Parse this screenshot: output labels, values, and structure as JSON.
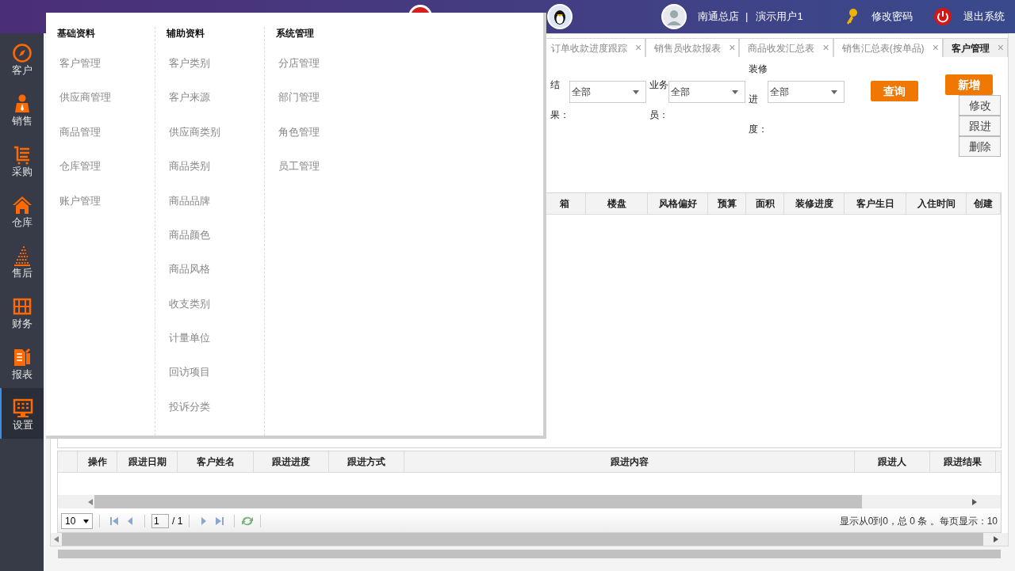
{
  "header": {
    "store": "南通总店",
    "separator": "|",
    "user": "演示用户1",
    "change_password": "修改密码",
    "logout": "退出系统"
  },
  "sidebar": {
    "items": [
      {
        "label": "客户",
        "selected": false
      },
      {
        "label": "销售",
        "selected": false
      },
      {
        "label": "采购",
        "selected": false
      },
      {
        "label": "仓库",
        "selected": false
      },
      {
        "label": "售后",
        "selected": false
      },
      {
        "label": "财务",
        "selected": false
      },
      {
        "label": "报表",
        "selected": false
      },
      {
        "label": "设置",
        "selected": true
      }
    ]
  },
  "tabs": [
    {
      "label": "订单收款进度跟踪",
      "selected": false,
      "close": "×"
    },
    {
      "label": "销售员收款报表",
      "selected": false,
      "close": "×"
    },
    {
      "label": "商品收发汇总表",
      "selected": false,
      "close": "×"
    },
    {
      "label": "销售汇总表(按单品)",
      "selected": false,
      "close": "×"
    },
    {
      "label": "客户管理",
      "selected": true,
      "close": "×"
    }
  ],
  "filters": [
    {
      "label": "结果：",
      "value": "全部"
    },
    {
      "label": "业务员：",
      "value": "全部"
    },
    {
      "label": "装修进度：",
      "value": "全部"
    }
  ],
  "search_button": "查询",
  "actions": [
    {
      "label": "新增",
      "kind": "primary"
    },
    {
      "label": "修改",
      "kind": "secondary"
    },
    {
      "label": "跟进",
      "kind": "secondary"
    },
    {
      "label": "删除",
      "kind": "secondary"
    }
  ],
  "customer_table": {
    "columns": [
      "箱",
      "楼盘",
      "风格偏好",
      "预算",
      "面积",
      "装修进度",
      "客户生日",
      "入住时间",
      "创建"
    ]
  },
  "followup_table": {
    "columns": [
      "操作",
      "跟进日期",
      "客户姓名",
      "跟进进度",
      "跟进方式",
      "跟进内容",
      "跟进人",
      "跟进结果"
    ]
  },
  "pager": {
    "page_size": "10",
    "page": "1",
    "total_pages": "/ 1",
    "summary": "显示从0到0，总 0 条 。每页显示：10"
  },
  "menu": {
    "columns": [
      {
        "title": "基础资料",
        "items": [
          "客户管理",
          "供应商管理",
          "商品管理",
          "仓库管理",
          "账户管理"
        ]
      },
      {
        "title": "辅助资料",
        "items": [
          "客户类别",
          "客户来源",
          "供应商类别",
          "商品类别",
          "商品品牌",
          "商品颜色",
          "商品风格",
          "收支类别",
          "计量单位",
          "回访项目",
          "投诉分类"
        ]
      },
      {
        "title": "系统管理",
        "items": [
          "分店管理",
          "部门管理",
          "角色管理",
          "员工管理"
        ]
      }
    ]
  }
}
